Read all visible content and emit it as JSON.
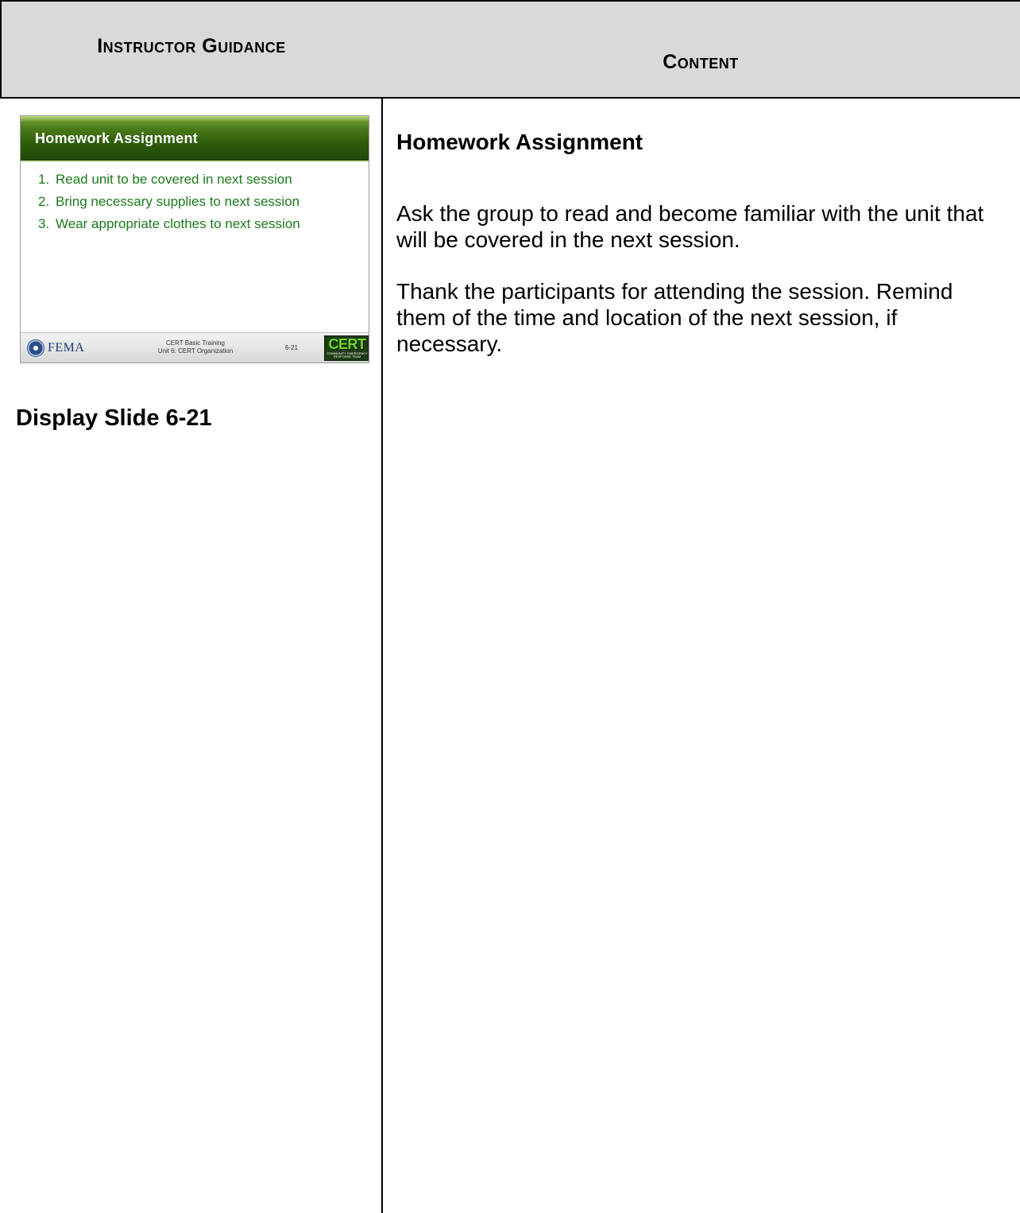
{
  "header": {
    "left_title": "Instructor Guidance",
    "right_title": "Content"
  },
  "slide": {
    "title": "Homework Assignment",
    "items": [
      {
        "num": "1.",
        "text": "Read unit to be covered in next session"
      },
      {
        "num": "2.",
        "text": "Bring necessary supplies to next session"
      },
      {
        "num": "3.",
        "text": "Wear appropriate clothes to next session"
      }
    ],
    "footer": {
      "agency": "FEMA",
      "course_line1": "CERT Basic Training",
      "course_line2": "Unit 6: CERT Organization",
      "slide_number": "6-21",
      "logo_text": "CERT",
      "logo_subtext": "COMMUNITY EMERGENCY RESPONSE TEAM"
    }
  },
  "left_caption": "Display Slide 6-21",
  "content": {
    "heading": "Homework Assignment",
    "paragraphs": [
      "Ask the group to read and become familiar with the unit that will be covered in the next session.",
      "Thank the participants for attending the session. Remind them of the time and location of the next session, if necessary."
    ]
  }
}
